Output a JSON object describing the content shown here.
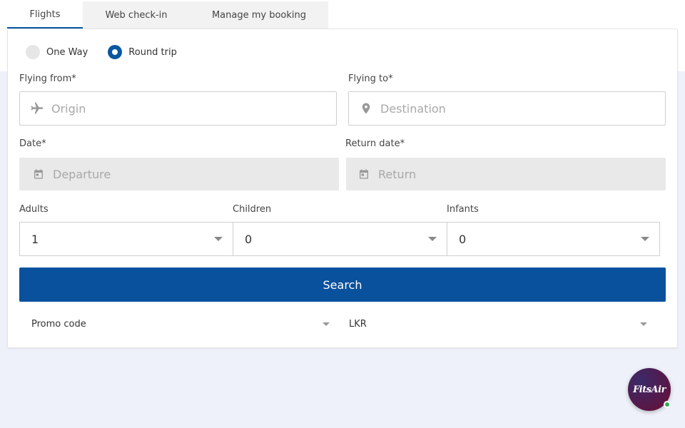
{
  "tabs": [
    {
      "label": "Flights",
      "active": true
    },
    {
      "label": "Web check-in",
      "active": false
    },
    {
      "label": "Manage my booking",
      "active": false
    }
  ],
  "trip_type": {
    "options": [
      {
        "label": "One Way",
        "checked": false
      },
      {
        "label": "Round trip",
        "checked": true
      }
    ]
  },
  "flying_from": {
    "label": "Flying from*",
    "placeholder": "Origin",
    "icon": "plane-icon"
  },
  "flying_to": {
    "label": "Flying to*",
    "placeholder": "Destination",
    "icon": "map-pin-icon"
  },
  "date": {
    "label": "Date*",
    "placeholder": "Departure",
    "icon": "calendar-icon"
  },
  "return_date": {
    "label": "Return date*",
    "placeholder": "Return",
    "icon": "calendar-icon"
  },
  "passengers": {
    "adults": {
      "label": "Adults",
      "value": "1"
    },
    "children": {
      "label": "Children",
      "value": "0"
    },
    "infants": {
      "label": "Infants",
      "value": "0"
    }
  },
  "search_button": {
    "label": "Search"
  },
  "promo_code": {
    "label": "Promo code"
  },
  "currency": {
    "value": "LKR"
  },
  "chat": {
    "logo_text": "FitsAir"
  },
  "colors": {
    "primary": "#0a519d",
    "tab_active_underline": "#0a57a0",
    "background_band": "#eef0fa",
    "online": "#2eae4e"
  }
}
